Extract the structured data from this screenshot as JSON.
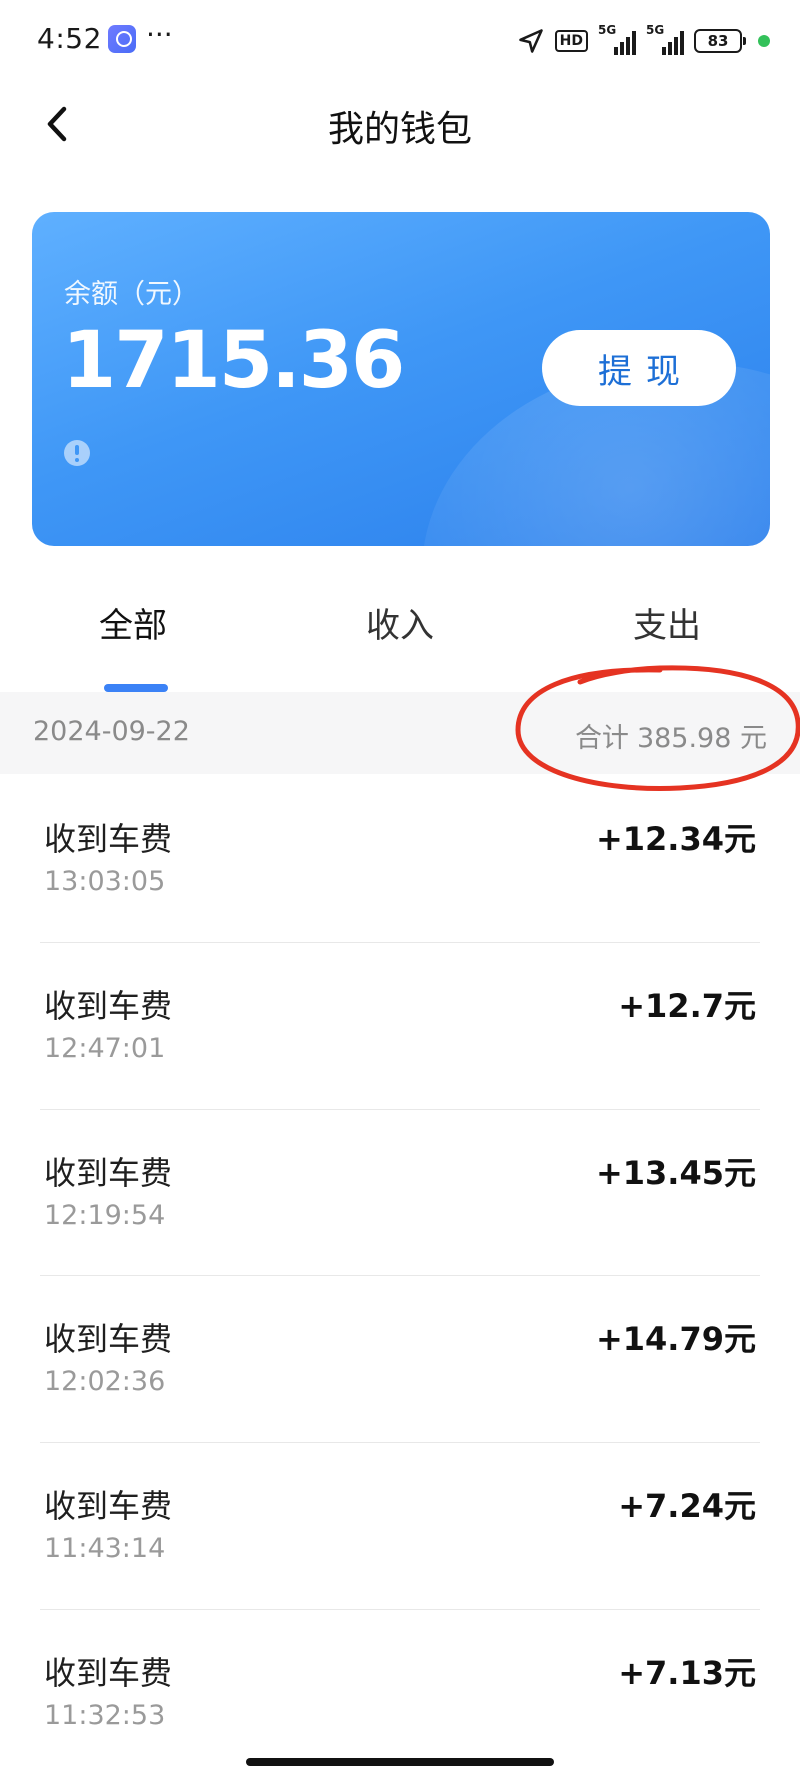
{
  "status_bar": {
    "time": "4:52",
    "dots": "···",
    "hd": "HD",
    "sig1": "5G",
    "sig2": "5G",
    "battery": "83"
  },
  "nav": {
    "title": "我的钱包"
  },
  "balance": {
    "label": "余额（元）",
    "amount": "1715.36",
    "withdraw_label": "提现"
  },
  "tabs": [
    {
      "label": "全部",
      "active": true
    },
    {
      "label": "收入",
      "active": false
    },
    {
      "label": "支出",
      "active": false
    }
  ],
  "summary": {
    "date": "2024-09-22",
    "total_label": "合计",
    "total_value": "385.98 元"
  },
  "records": [
    {
      "title": "收到车费",
      "time": "13:03:05",
      "amount": "+12.34元"
    },
    {
      "title": "收到车费",
      "time": "12:47:01",
      "amount": "+12.7元"
    },
    {
      "title": "收到车费",
      "time": "12:19:54",
      "amount": "+13.45元"
    },
    {
      "title": "收到车费",
      "time": "12:02:36",
      "amount": "+14.79元"
    },
    {
      "title": "收到车费",
      "time": "11:43:14",
      "amount": "+7.24元"
    },
    {
      "title": "收到车费",
      "time": "11:32:53",
      "amount": "+7.13元"
    }
  ],
  "colors": {
    "accent": "#3b82f6",
    "card_start": "#5fb0ff",
    "card_end": "#2a7fec",
    "annotation": "#e53322"
  }
}
